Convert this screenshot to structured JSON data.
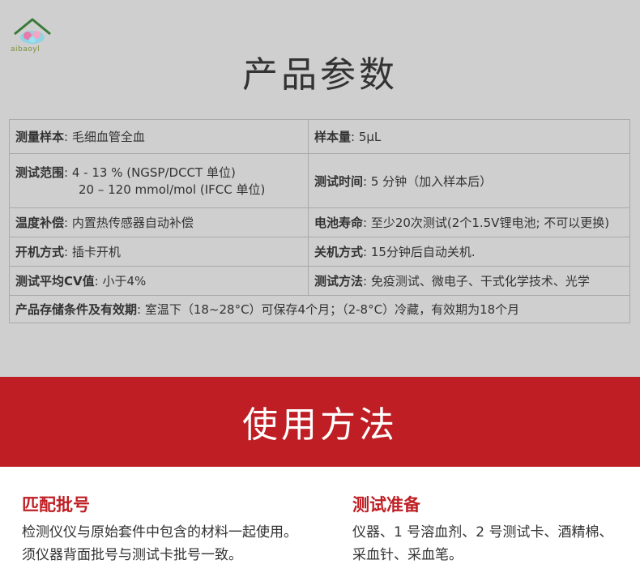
{
  "brand": {
    "logo_text": "aibaoyl"
  },
  "params": {
    "title": "产品参数",
    "rows": [
      {
        "a_label": "测量样本",
        "a_value": "毛细血管全血",
        "b_label": "样本量",
        "b_value": "5μL"
      },
      {
        "a_label": "测试范围",
        "a_value": "4 - 13 % (NGSP/DCCT 单位)",
        "a_value2": "20 – 120 mmol/mol (IFCC 单位)",
        "b_label": "测试时间",
        "b_value": "5 分钟（加入样本后）"
      },
      {
        "a_label": "温度补偿",
        "a_value": "内置热传感器自动补偿",
        "b_label": "电池寿命",
        "b_value": "至少20次测试(2个1.5V锂电池; 不可以更换)"
      },
      {
        "a_label": "开机方式",
        "a_value": "插卡开机",
        "b_label": "关机方式",
        "b_value": "15分钟后自动关机."
      },
      {
        "a_label": "测试平均CV值",
        "a_value": "小于4%",
        "b_label": "测试方法",
        "b_value": "免疫测试、微电子、干式化学技术、光学"
      },
      {
        "a_label": "产品存储条件及有效期",
        "a_value": "室温下（18~28°C）可保存4个月；（2-8°C）冷藏，有效期为18个月"
      }
    ]
  },
  "usage": {
    "title": "使用方法",
    "sections": [
      {
        "title": "匹配批号",
        "lines": [
          "检测仪仪与原始套件中包含的材料一起使用。",
          "须仪器背面批号与测试卡批号一致。"
        ]
      },
      {
        "title": "测试准备",
        "lines": [
          "仪器、1 号溶血剂、2 号测试卡、酒精棉、",
          "采血针、采血笔。"
        ]
      }
    ]
  }
}
